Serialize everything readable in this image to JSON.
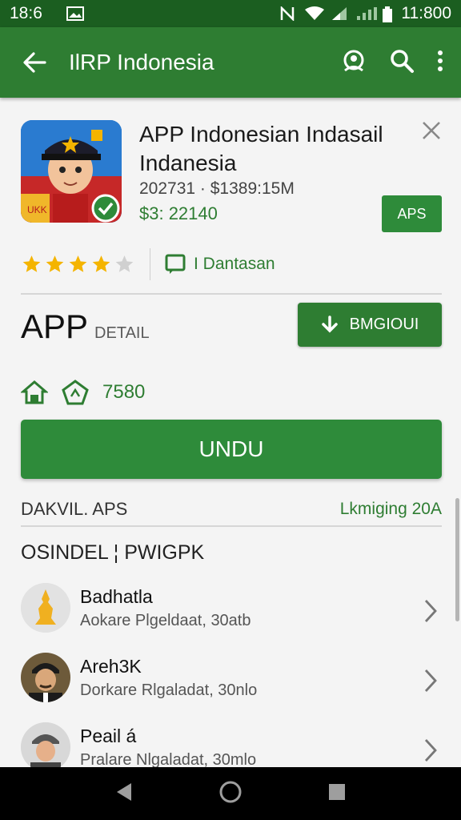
{
  "status_bar": {
    "time_left": "18:6",
    "time_right": "11:800"
  },
  "app_bar": {
    "title": "IlRP Indonesia",
    "icons": [
      "back-arrow-icon",
      "profile-icon",
      "search-icon",
      "more-vert-icon"
    ]
  },
  "app": {
    "name": "APP Indonesian Indasail Indanesia",
    "meta": "202731 · $1389:15M",
    "price": "$3: 22140",
    "badge": "APS",
    "icon_label": "UKK"
  },
  "rating": {
    "stars_filled": 4,
    "stars_total": 5,
    "tag_label": "I Dantasan"
  },
  "detail": {
    "title": "APP",
    "subtitle": "DETAIL",
    "download_label": "BMGIOUI"
  },
  "stats": {
    "value": "7580"
  },
  "primary_button": {
    "label": "UNDU"
  },
  "section": {
    "label": "DAKVIL. APS",
    "link": "Lkmiging 20A"
  },
  "list_title": "OSINDEL ¦ PWIGPK",
  "list_items": [
    {
      "name": "Badhatla",
      "sub": "Aokare Plgeldaat, 30atb"
    },
    {
      "name": "Areh3K",
      "sub": "Dorkare Rlgaladat, 30nlo"
    },
    {
      "name": "Peail á",
      "sub": "Pralare Nlgaladat, 30mlo"
    }
  ],
  "colors": {
    "status_bar": "#1b5e20",
    "app_bar": "#2e7d32",
    "accent": "#2e7d32",
    "button": "#2e8b3a",
    "star": "#f4b400"
  }
}
